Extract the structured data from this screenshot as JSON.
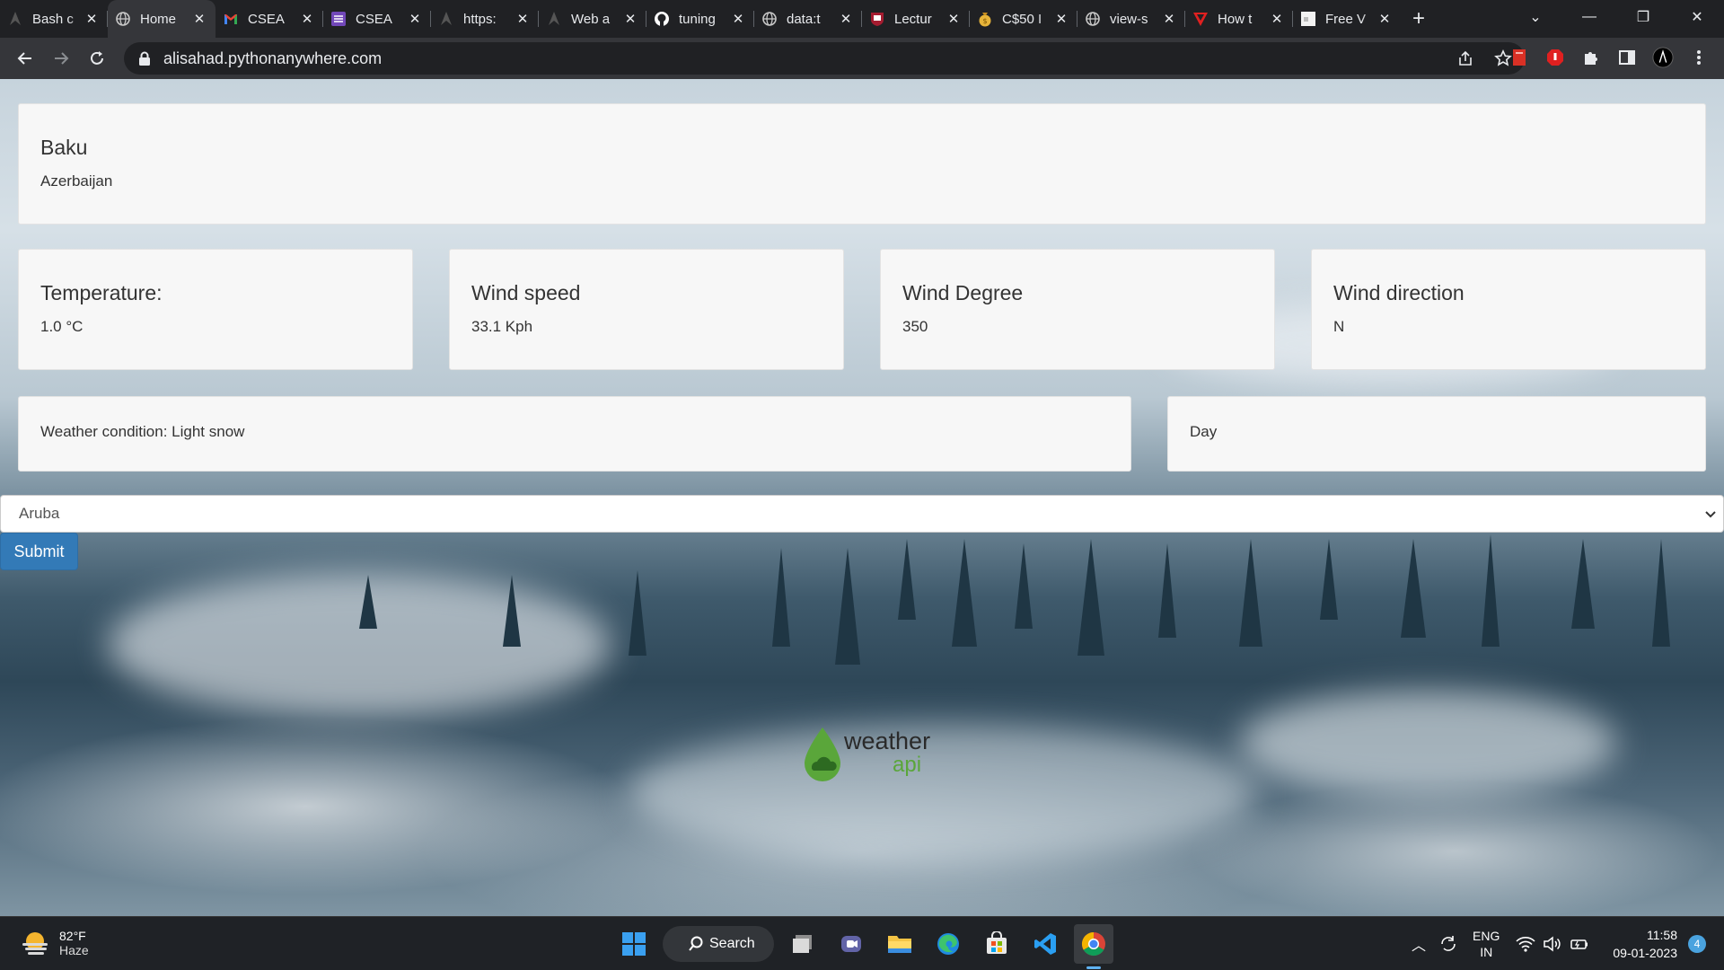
{
  "browser": {
    "tabs": [
      {
        "label": "Bash c",
        "icon": "github-dark-icon",
        "active": false
      },
      {
        "label": "Home",
        "icon": "globe-icon",
        "active": true
      },
      {
        "label": "CSEA",
        "icon": "gmail-icon",
        "active": false
      },
      {
        "label": "CSEA",
        "icon": "list-icon",
        "active": false
      },
      {
        "label": "https:",
        "icon": "github-dark-icon",
        "active": false
      },
      {
        "label": "Web a",
        "icon": "github-dark-icon",
        "active": false
      },
      {
        "label": "tuning",
        "icon": "github-icon",
        "active": false
      },
      {
        "label": "data:t",
        "icon": "globe-icon",
        "active": false
      },
      {
        "label": "Lectur",
        "icon": "harvard-icon",
        "active": false
      },
      {
        "label": "C$50 I",
        "icon": "money-bag-icon",
        "active": false
      },
      {
        "label": "view-s",
        "icon": "globe-icon",
        "active": false
      },
      {
        "label": "How t",
        "icon": "vivaldi-icon",
        "active": false
      },
      {
        "label": "Free V",
        "icon": "page-icon",
        "active": false
      }
    ],
    "new_tab": "+",
    "url": "alisahad.pythonanywhere.com"
  },
  "weather": {
    "city": "Baku",
    "country": "Azerbaijan",
    "cards": [
      {
        "title": "Temperature:",
        "value": "1.0 °C"
      },
      {
        "title": "Wind speed",
        "value": "33.1 Kph"
      },
      {
        "title": "Wind Degree",
        "value": "350"
      },
      {
        "title": "Wind direction",
        "value": "N"
      }
    ],
    "condition": "Weather condition: Light snow",
    "day_night": "Day",
    "country_select": "Aruba",
    "submit_label": "Submit",
    "logo_text_1": "weather",
    "logo_text_2": "api"
  },
  "taskbar": {
    "temp": "82°F",
    "condition": "Haze",
    "search_label": "Search",
    "lang_1": "ENG",
    "lang_2": "IN",
    "time": "11:58",
    "date": "09-01-2023",
    "notifications": "4"
  },
  "colors": {
    "accent": "#337ab7",
    "card_bg": "#f7f7f7",
    "chrome_dark": "#202124",
    "chrome_toolbar": "#35363a"
  }
}
